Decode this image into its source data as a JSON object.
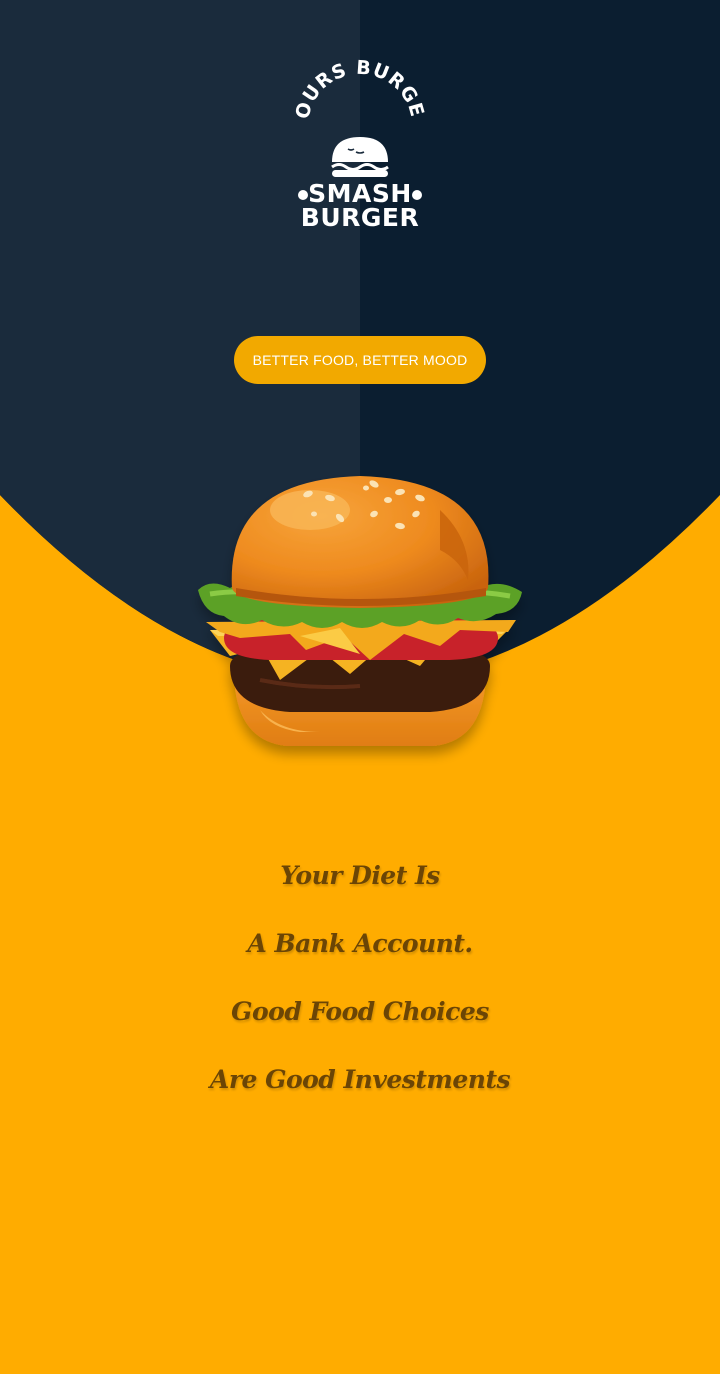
{
  "brand": {
    "arc_text": "YOURS BURGER",
    "word_top": "SMASH",
    "word_bottom": "BURGER"
  },
  "cta": {
    "label": "BETTER FOOD, BETTER MOOD"
  },
  "quote": {
    "lines": [
      "Your Diet Is",
      "A Bank Account.",
      "Good Food Choices",
      "Are Good Investments"
    ]
  },
  "colors": {
    "navy_dark": "#0B1E30",
    "navy_light": "#1A2B3C",
    "accent_yellow": "#FFAC00",
    "button": "#F2A900",
    "quote_text": "#6B4505"
  },
  "icons": {
    "logo": "burger-logo-icon",
    "hero": "burger-illustration"
  }
}
